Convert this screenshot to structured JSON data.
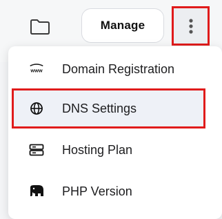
{
  "toolbar": {
    "manage_label": "Manage",
    "folder_icon": "folder-icon",
    "more_icon": "more-vertical-icon"
  },
  "menu": {
    "items": [
      {
        "label": "Domain Registration",
        "icon": "www-icon"
      },
      {
        "label": "DNS Settings",
        "icon": "globe-icon",
        "highlighted": true
      },
      {
        "label": "Hosting Plan",
        "icon": "server-icon"
      },
      {
        "label": "PHP Version",
        "icon": "elephant-icon"
      }
    ]
  },
  "colors": {
    "highlight_border": "#e01b1b",
    "active_item_bg": "#eef1f7"
  }
}
